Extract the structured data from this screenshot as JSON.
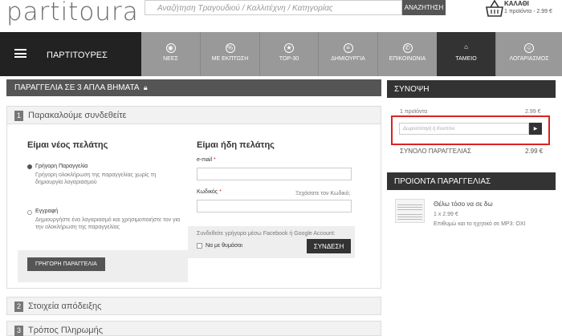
{
  "brand": {
    "logo": "partitoura"
  },
  "search": {
    "placeholder": "Αναζήτηση Τραγουδιού / Καλλιτέχνη / Κατηγορίας",
    "button": "ΑΝΑΖΗΤΗΣΗ"
  },
  "cart": {
    "title": "ΚΑΛΑΘΙ",
    "summary": "1 προϊόντα - 2.99 €"
  },
  "nav": {
    "main": "ΠΑΡΤΙΤΟΥΡΕΣ",
    "items": [
      {
        "label": "ΝΕΕΣ",
        "icon": "compass-icon"
      },
      {
        "label": "ΜΕ ΕΚΠΤΩΣΗ",
        "icon": "percent-icon"
      },
      {
        "label": "TOP-30",
        "icon": "star-icon"
      },
      {
        "label": "ΔΗΜΙΟΥΡΓΙΑ",
        "icon": "list-icon"
      },
      {
        "label": "ΕΠΙΚΟΙΝΩΝΙΑ",
        "icon": "phone-icon"
      },
      {
        "label": "ΤΑΜΕΙΟ",
        "icon": "basket-icon"
      },
      {
        "label": "ΛΟΓΑΡΙΑΣΜΟΣ",
        "icon": "user-icon"
      }
    ]
  },
  "checkout": {
    "title": "ΠΑΡΑΓΓΕΛΙΑ ΣΕ 3 ΑΠΛΑ ΒΗΜΑΤΑ",
    "steps": [
      {
        "num": "1",
        "label": "Παρακαλούμε συνδεθείτε"
      },
      {
        "num": "2",
        "label": "Στοιχεία απόδειξης"
      },
      {
        "num": "3",
        "label": "Τρόπος Πληρωμής"
      }
    ],
    "new_customer": {
      "title": "Είμαι νέος πελάτης",
      "option1_label": "Γρήγορη Παραγγελία",
      "option1_desc": "Γρήγορη ολοκλήρωση της παραγγελίας χωρίς τη δημιουργία λογαριασμού",
      "option2_label": "Εγγραφή",
      "option2_desc": "Δημιουργήστε ένα λογαριασμό και χρησιμοποιήστε τον για την ολοκλήρωση της παραγγελίας",
      "button": "ΓΡΗΓΟΡΗ ΠΑΡΑΓΓΕΛΙΑ"
    },
    "existing_customer": {
      "title": "Είμαι ήδη πελάτης",
      "email_label": "e-mail",
      "password_label": "Κωδικός",
      "required": "*",
      "forgot": "Ξεχάσατε τον Κωδικό;",
      "social_text": "Συνδεθείτε γρήγορα μέσω Facebook ή Google Account:",
      "remember": "Να με θυμάσαι",
      "login_button": "ΣΥΝΔΕΣΗ"
    }
  },
  "summary": {
    "title": "ΣΥΝΟΨΗ",
    "items_label": "1 προϊόντα",
    "items_value": "2.99 €",
    "coupon_placeholder": "Δωροεπιταγή ή Κουπόνι",
    "coupon_button": "▶",
    "total_label": "ΣΥΝΟΛΟ ΠΑΡΑΓΓΕΛΙΑΣ",
    "total_value": "2.99 €"
  },
  "order_products": {
    "title": "ΠΡΟΙΟΝΤΑ ΠΑΡΑΓΓΕΛΙΑΣ",
    "items": [
      {
        "name": "Θέλω τόσο να σε δω",
        "qty_price": "1 x 2.99 €",
        "desc": "Επιθυμώ και το ηχητικό σε MP3: ΟΧΙ"
      }
    ]
  },
  "colors": {
    "dark": "#333333",
    "nav_grey": "#999999",
    "highlight_red": "#dd2222"
  }
}
